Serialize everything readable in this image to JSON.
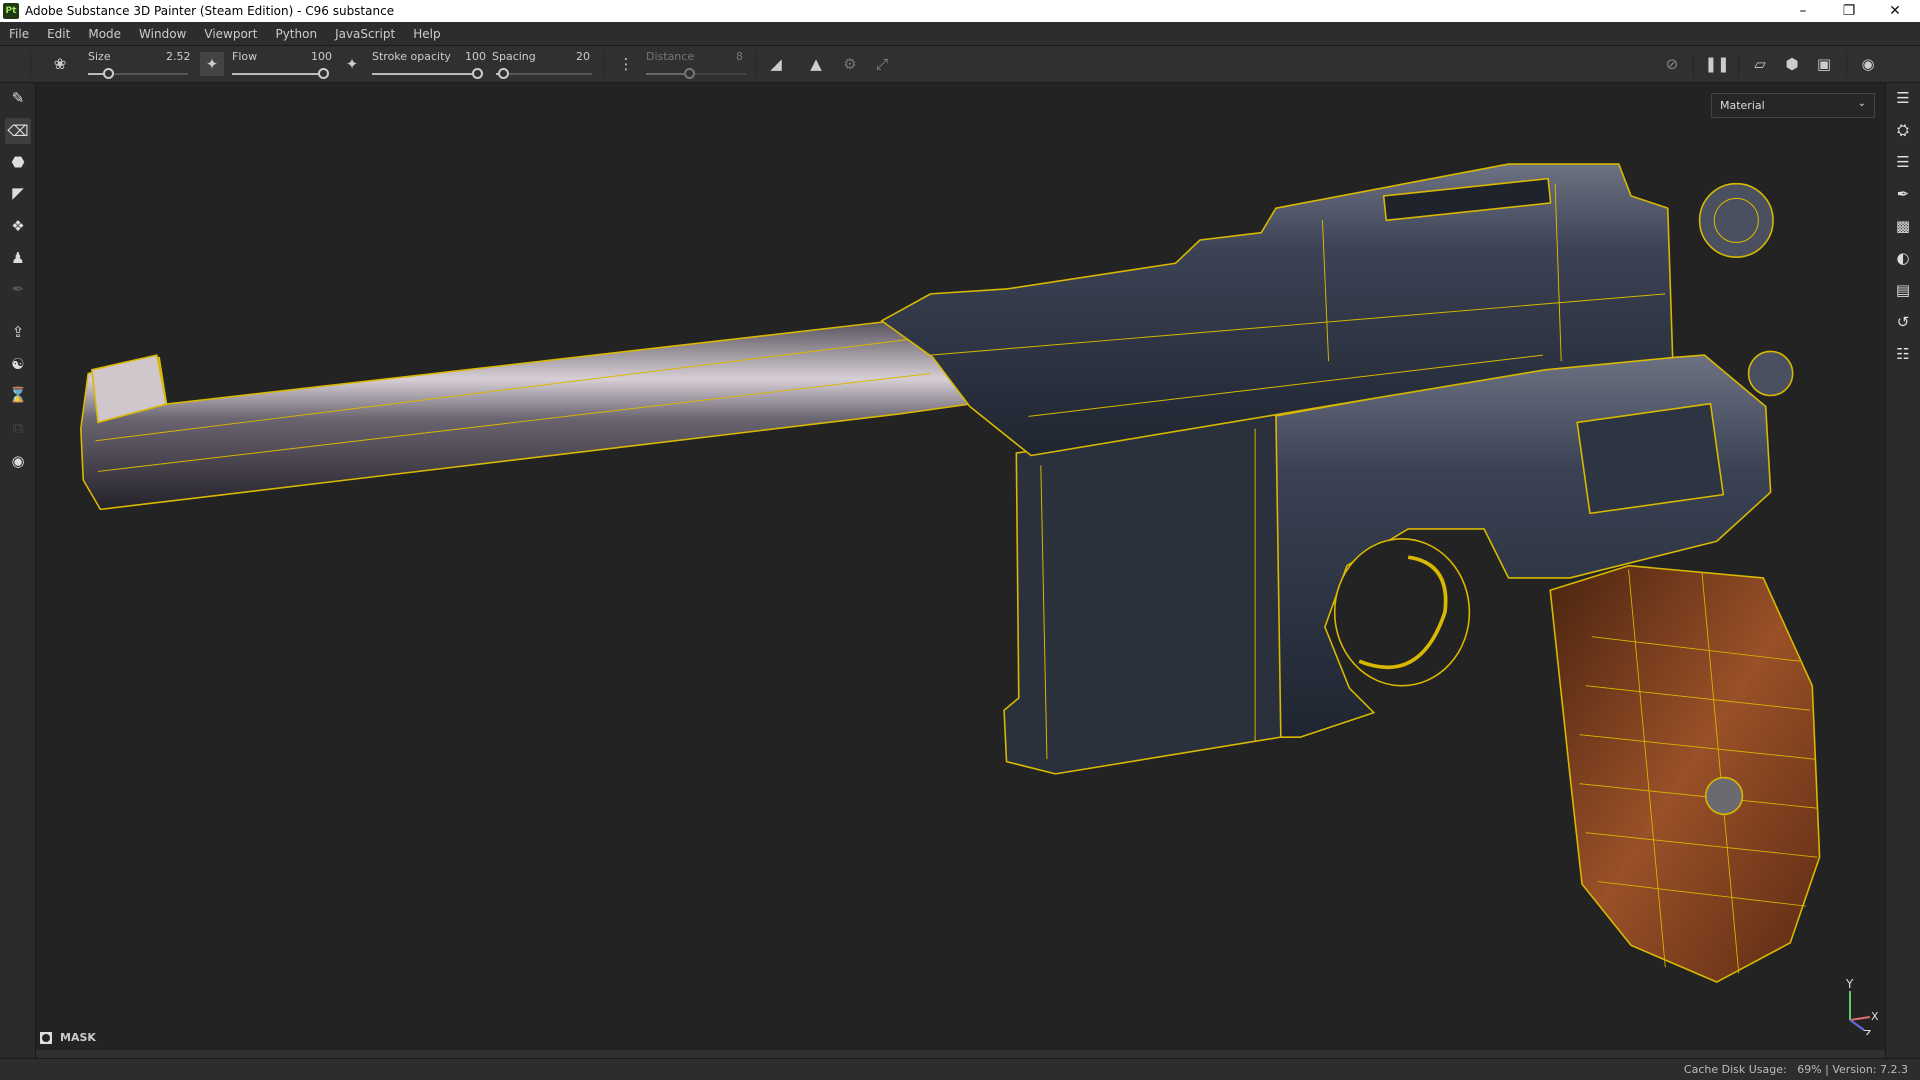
{
  "titlebar": {
    "app_icon": "Pt",
    "title": "Adobe Substance 3D Painter (Steam Edition) - C96 substance"
  },
  "menu": [
    "File",
    "Edit",
    "Mode",
    "Window",
    "Viewport",
    "Python",
    "JavaScript",
    "Help"
  ],
  "toolbar": {
    "size": {
      "label": "Size",
      "value": "2.52",
      "fraction": 0.2
    },
    "flow": {
      "label": "Flow",
      "value": "100",
      "fraction": 1.0
    },
    "stroke_opacity": {
      "label": "Stroke opacity",
      "value": "100",
      "fraction": 1.0
    },
    "spacing": {
      "label": "Spacing",
      "value": "20",
      "fraction": 0.05
    },
    "distance": {
      "label": "Distance",
      "value": "8",
      "fraction": 0.4
    }
  },
  "viewport": {
    "display_mode": "Material",
    "mask_label": "MASK",
    "axes": [
      "Y",
      "X",
      "Z"
    ]
  },
  "status": {
    "text": "Cache Disk Usage:   69% | Version: 7.2.3"
  },
  "colors": {
    "wireframe": "#d8b800",
    "background": "#232323",
    "panel": "#2b2b2b"
  }
}
